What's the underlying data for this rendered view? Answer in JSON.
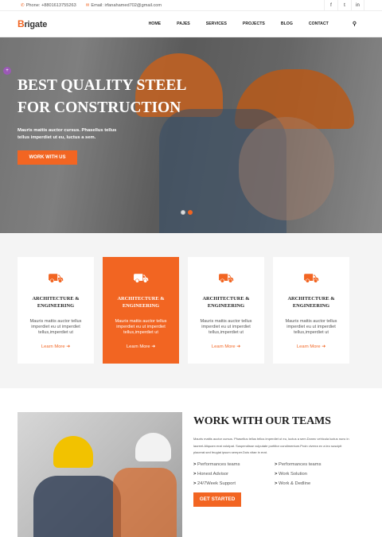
{
  "topbar": {
    "phone": "Phone: +8801613755263",
    "email": "Email: irfanahamed702@gmail.com",
    "social": [
      "f",
      "t",
      "in"
    ]
  },
  "nav": {
    "logo_letter": "B",
    "logo_rest": "rigate",
    "items": [
      "HOME",
      "PAJES",
      "SERVICES",
      "PROJECTS",
      "BLOG",
      "CONTACT"
    ]
  },
  "hero": {
    "title": "BEST QUALITY STEEL FOR CONSTRUCTION",
    "subtitle": "Mauris mattis auctor cursus. Phasellus tellus tellus imperdiet ut eu, luctus a sem.",
    "button": "WORK WITH US",
    "badge": "+"
  },
  "services": [
    {
      "title": "ARCHITECTURE & ENGINEERING",
      "text": "Mauris mattis auctor tellus imperdiet eu ut imperdiet tellus,imperdiet ut",
      "more": "Learn More"
    },
    {
      "title": "ARCHITECTURE & ENGINEERING",
      "text": "Mauris mattis auctor tellus imperdiet eu ut imperdiet tellus,imperdiet ut",
      "more": "Learn More"
    },
    {
      "title": "ARCHITECTURE & ENGINEERING",
      "text": "Mauris mattis auctor tellus imperdiet eu ut imperdiet tellus,imperdiet ut",
      "more": "Learn More"
    },
    {
      "title": "ARCHITECTURE & ENGINEERING",
      "text": "Mauris mattis auctor tellus imperdiet eu ut imperdiet tellus,imperdiet ut",
      "more": "Learn More"
    }
  ],
  "work": {
    "title": "WORK WITH OUR TEAMS",
    "text": "Mauris mattis auctor cursus. Phasellus tellus tellus imperdiet ut eu, luctus a sem.Donec vehicula luctus nunc in laoreet.Aliquam erat volutpat. Suspendisse vulputate porttitor condimentum.Proin viverra ex a leo suscipit placerat.sed feugiat ipsum semper.Duis vitae in erat.",
    "list": [
      "Performances teams",
      "Performances teams",
      "Honest Advisor",
      "Work Solution",
      "24/7Week Support",
      "Work & Dedline"
    ],
    "button": "GET STARTED"
  }
}
